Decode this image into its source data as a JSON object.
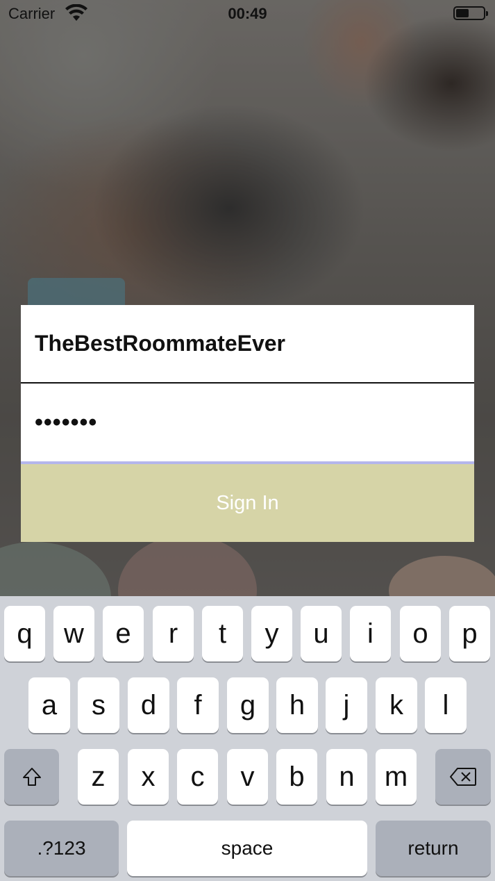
{
  "status_bar": {
    "carrier": "Carrier",
    "time": "00:49",
    "wifi_icon": "wifi-icon",
    "battery_icon": "battery-icon"
  },
  "login": {
    "username_value": "TheBestRoommateEver",
    "password_value": "•••••••",
    "sign_in_label": "Sign In",
    "sign_in_color": "#d6d4a7",
    "password_focus_color": "#b4b6ec"
  },
  "keyboard": {
    "row1": [
      "q",
      "w",
      "e",
      "r",
      "t",
      "y",
      "u",
      "i",
      "o",
      "p"
    ],
    "row2": [
      "a",
      "s",
      "d",
      "f",
      "g",
      "h",
      "j",
      "k",
      "l"
    ],
    "row3": [
      "z",
      "x",
      "c",
      "v",
      "b",
      "n",
      "m"
    ],
    "shift_icon": "shift-arrow-icon",
    "delete_icon": "backspace-icon",
    "numbers_label": ".?123",
    "space_label": "space",
    "return_label": "return"
  }
}
